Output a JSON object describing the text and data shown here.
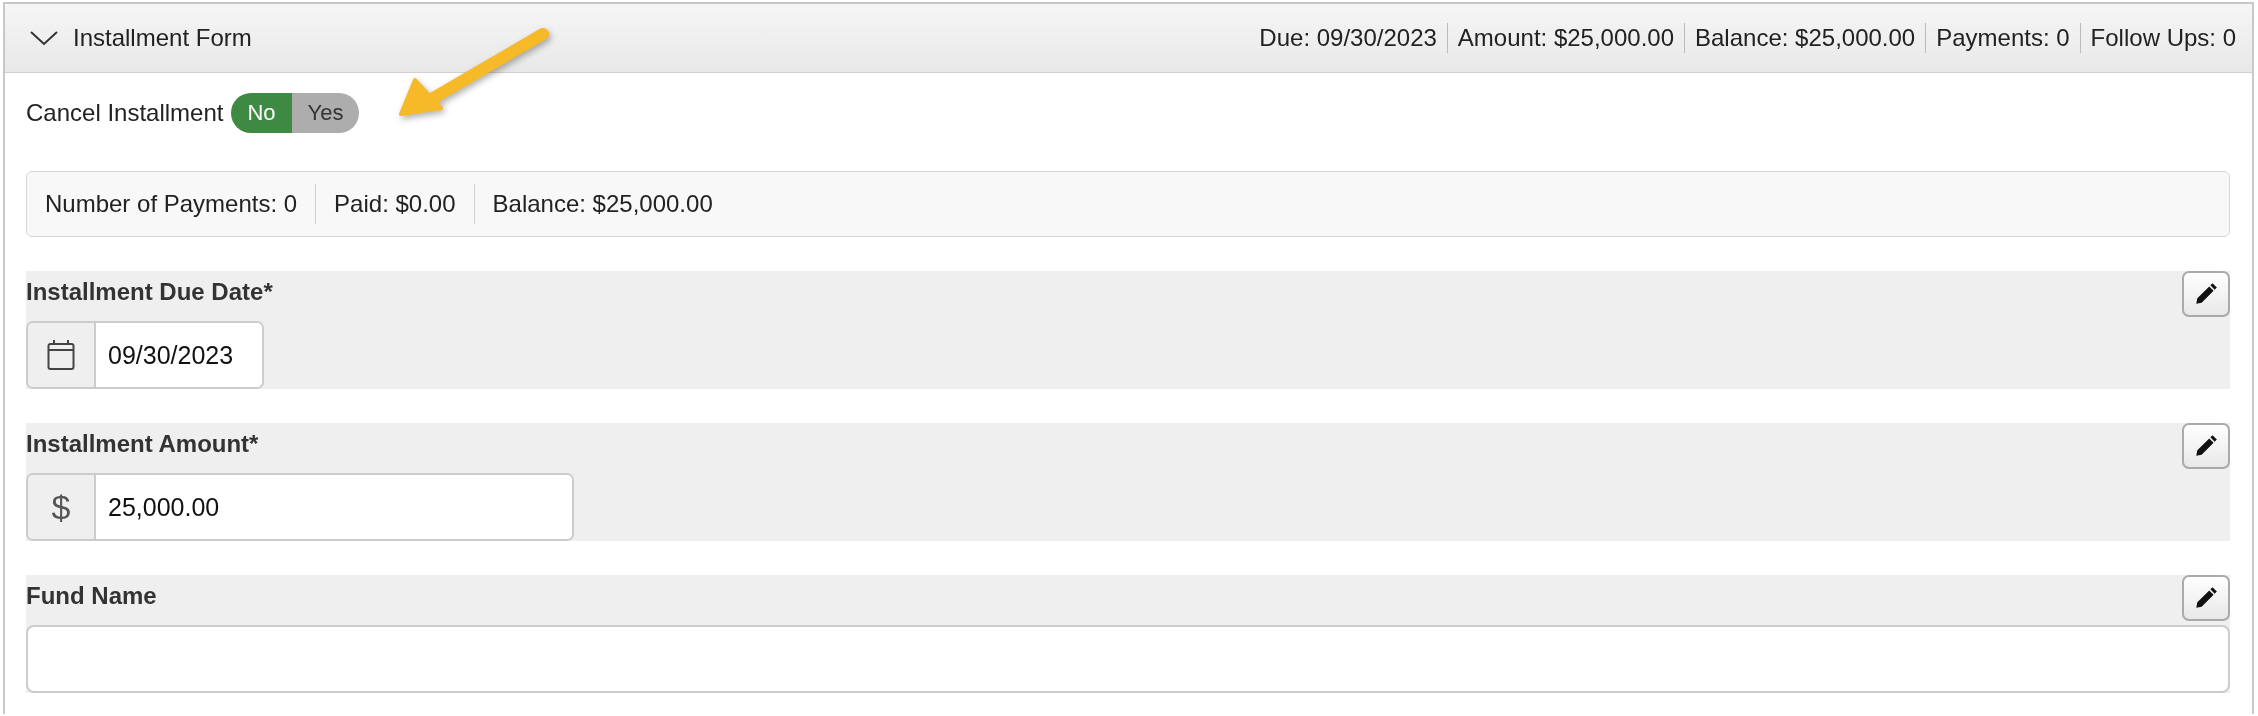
{
  "panel": {
    "title": "Installment Form",
    "expanded": true,
    "summary": [
      "Due: 09/30/2023",
      "Amount: $25,000.00",
      "Balance: $25,000.00",
      "Payments: 0",
      "Follow Ups: 0"
    ]
  },
  "cancel_installment": {
    "label": "Cancel Installment",
    "options": [
      {
        "label": "No",
        "selected": true
      },
      {
        "label": "Yes",
        "selected": false
      }
    ]
  },
  "totals": [
    "Number of Payments: 0",
    "Paid: $0.00",
    "Balance: $25,000.00"
  ],
  "fields": [
    {
      "label": "Installment Due Date*",
      "kind": "date",
      "value": "09/30/2023"
    },
    {
      "label": "Installment Amount*",
      "kind": "currency",
      "prefix": "$",
      "value": "25,000.00"
    },
    {
      "label": "Fund Name",
      "kind": "text"
    }
  ]
}
